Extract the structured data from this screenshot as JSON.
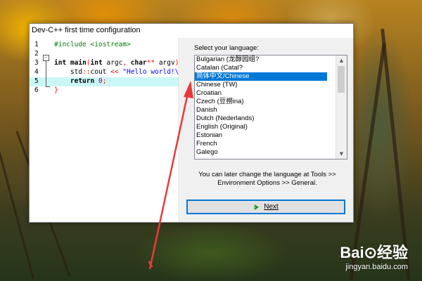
{
  "window": {
    "title": "Dev-C++ first time configuration"
  },
  "editor": {
    "lines": [
      {
        "number": "1",
        "tokens": [
          {
            "t": "#include <iostream>",
            "c": "pp"
          }
        ]
      },
      {
        "number": "2",
        "tokens": []
      },
      {
        "number": "3",
        "tokens": [
          {
            "t": "int",
            "c": "kw"
          },
          {
            "t": " ",
            "c": ""
          },
          {
            "t": "main",
            "c": "kw"
          },
          {
            "t": "(",
            "c": "op"
          },
          {
            "t": "int",
            "c": "kw"
          },
          {
            "t": " argc",
            "c": ""
          },
          {
            "t": ", ",
            "c": "op"
          },
          {
            "t": "char",
            "c": "kw"
          },
          {
            "t": "** ",
            "c": "op"
          },
          {
            "t": "argv",
            "c": ""
          },
          {
            "t": ")",
            "c": "op"
          }
        ]
      },
      {
        "number": "4",
        "tokens": [
          {
            "t": "    std",
            "c": ""
          },
          {
            "t": "::",
            "c": "op"
          },
          {
            "t": "cout ",
            "c": ""
          },
          {
            "t": "<< ",
            "c": "op"
          },
          {
            "t": "\"Hello world!\\",
            "c": "str"
          }
        ]
      },
      {
        "number": "5",
        "highlight": true,
        "tokens": [
          {
            "t": "    ",
            "c": ""
          },
          {
            "t": "return",
            "c": "kw"
          },
          {
            "t": " ",
            "c": ""
          },
          {
            "t": "0",
            "c": "num"
          },
          {
            "t": ";",
            "c": "op"
          }
        ]
      },
      {
        "number": "6",
        "tokens": [
          {
            "t": "}",
            "c": "br"
          }
        ]
      }
    ]
  },
  "language": {
    "label": "Select your language:",
    "items": [
      "Bulgarian (龙醇园组?",
      "Catalan (Catal?",
      "简体中文/Chinese",
      "Chinese (TW)",
      "Croatian",
      "Czech (豆撈ina)",
      "Danish",
      "Dutch (Nederlands)",
      "English (Original)",
      "Estonian",
      "French",
      "Galego"
    ],
    "selected": "简体中文/Chinese",
    "scrollbar": {
      "up": "▲",
      "down": "▼"
    }
  },
  "hint": {
    "line1": "You can later change the language at Tools >>",
    "line2": "Environment Options >> General."
  },
  "next_button": {
    "label": "Next",
    "icon": "next-arrow-icon"
  },
  "annotation": {
    "color": "#e83a3a"
  },
  "watermark": {
    "logo": "Bai⊙经验",
    "url": "jingyan.baidu.com"
  }
}
